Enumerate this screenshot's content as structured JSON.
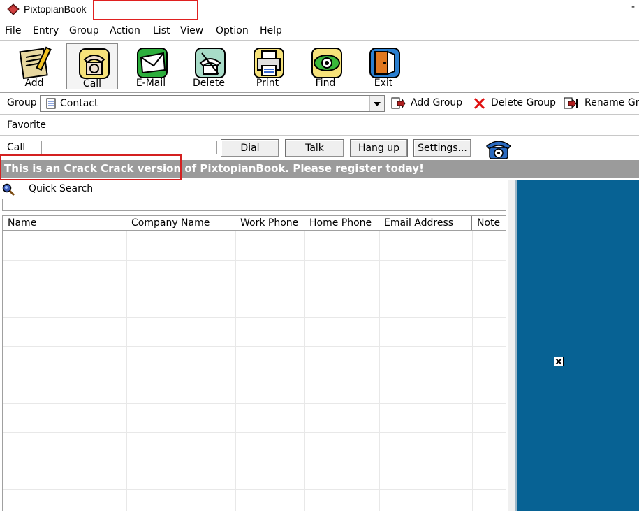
{
  "window": {
    "title": "PixtopianBook",
    "minimize_glyph": "-"
  },
  "menu": [
    {
      "label": "File"
    },
    {
      "label": "Entry"
    },
    {
      "label": "Group"
    },
    {
      "label": "Action"
    },
    {
      "label": "List"
    },
    {
      "label": "View"
    },
    {
      "label": "Option"
    },
    {
      "label": "Help"
    }
  ],
  "toolbar": {
    "add": "Add",
    "call": "Call",
    "email": "E-Mail",
    "delete": "Delete",
    "print": "Print",
    "find": "Find",
    "exit": "Exit"
  },
  "groupbar": {
    "label": "Group",
    "selected": "Contact",
    "add_group": "Add Group",
    "delete_group": "Delete Group",
    "rename_group": "Rename Gr"
  },
  "favorite": {
    "label": "Favorite"
  },
  "callbar": {
    "label": "Call",
    "number_value": "",
    "dial": "Dial",
    "talk": "Talk",
    "hang_up": "Hang up",
    "settings": "Settings..."
  },
  "banner": {
    "text": "This is an Crack Crack  version of PixtopianBook. Please register today!"
  },
  "quick_search": {
    "label": "Quick Search",
    "value": ""
  },
  "table": {
    "columns": [
      "Name",
      "Company Name",
      "Work Phone",
      "Home Phone",
      "Email Address",
      "Note"
    ],
    "rows": []
  },
  "colors": {
    "banner_bg": "#9b9b9b",
    "right_pane_bg": "#076294",
    "highlight_box": "#d42020"
  },
  "icons": {
    "app": "book-icon",
    "add": "notebook-pencil-icon",
    "call": "telephone-icon",
    "email": "envelope-icon",
    "delete": "delete-phone-icon",
    "print": "printer-icon",
    "find": "eye-icon",
    "exit": "door-exit-icon",
    "quick_search": "magnifier-icon",
    "phone_dial": "rotary-phone-icon",
    "broken_image": "broken-image-icon"
  }
}
